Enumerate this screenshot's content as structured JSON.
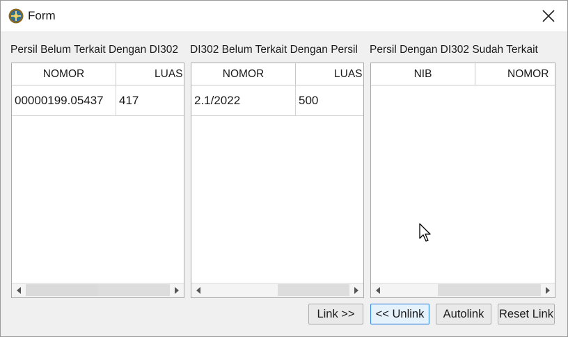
{
  "window": {
    "title": "Form"
  },
  "panels": [
    {
      "label": "Persil Belum Terkait Dengan DI302",
      "columns": [
        "NOMOR",
        "LUAS"
      ],
      "rows": [
        [
          "00000199.05437",
          "417"
        ]
      ]
    },
    {
      "label": "DI302 Belum Terkait Dengan Persil",
      "columns": [
        "NOMOR",
        "LUAS"
      ],
      "rows": [
        [
          "2.1/2022",
          "500"
        ]
      ]
    },
    {
      "label": "Persil Dengan DI302 Sudah Terkait",
      "columns": [
        "NIB",
        "NOMOR"
      ],
      "rows": []
    }
  ],
  "buttons": {
    "link": "Link >>",
    "unlink": "<< Unlink",
    "autolink": "Autolink",
    "reset": "Reset Link"
  },
  "icons": {
    "app": "government-seal-icon",
    "close": "close-icon",
    "scroll_left": "chevron-left-icon",
    "scroll_right": "chevron-right-icon",
    "cursor": "mouse-pointer-icon"
  }
}
